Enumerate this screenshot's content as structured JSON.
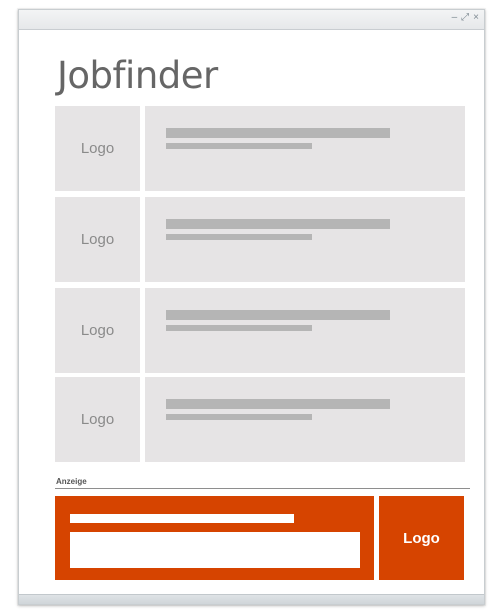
{
  "window": {
    "controls": [
      "–",
      "⤢",
      "×"
    ]
  },
  "app": {
    "title": "Jobfinder"
  },
  "jobs": [
    {
      "logo_label": "Logo"
    },
    {
      "logo_label": "Logo"
    },
    {
      "logo_label": "Logo"
    },
    {
      "logo_label": "Logo"
    }
  ],
  "ad": {
    "label": "Anzeige",
    "logo_label": "Logo",
    "accent_color": "#d64400"
  },
  "colors": {
    "placeholder_bg": "#e6e4e5",
    "placeholder_bar": "#b5b5b5",
    "title_text": "#666666"
  }
}
